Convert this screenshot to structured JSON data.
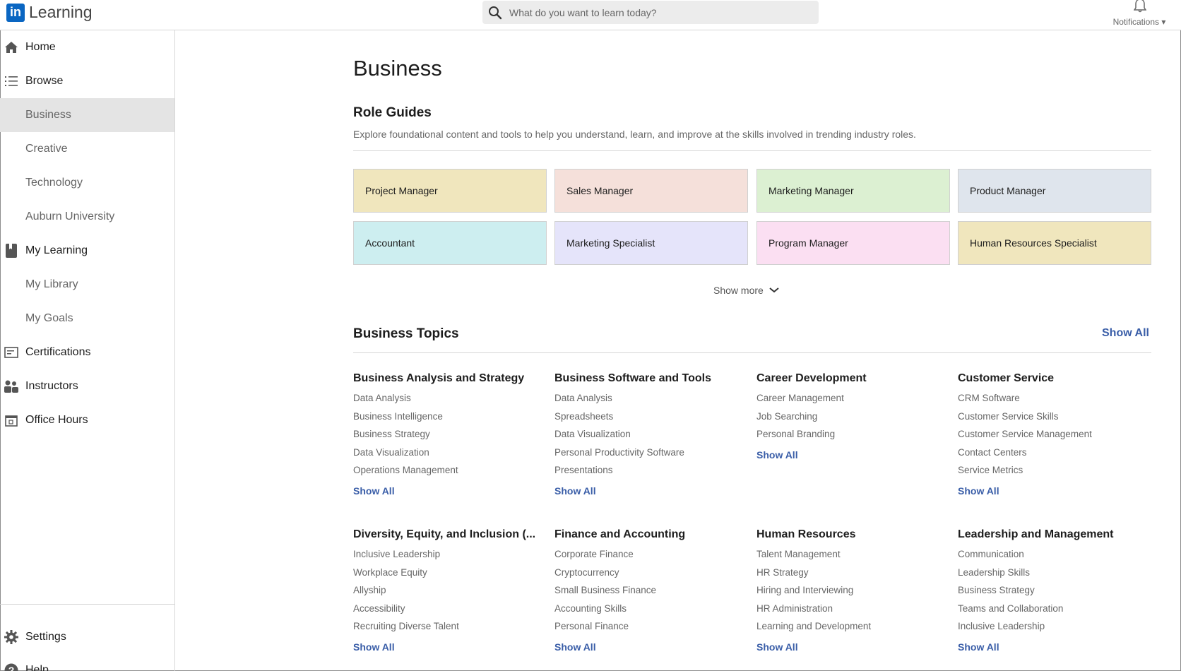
{
  "app": {
    "logo_mark": "in",
    "logo_text": "Learning"
  },
  "search": {
    "placeholder": "What do you want to learn today?"
  },
  "notifications": {
    "label": "Notifications"
  },
  "sidebar": {
    "items": [
      {
        "label": "Home",
        "icon": "home-icon"
      },
      {
        "label": "Browse",
        "icon": "list-icon"
      },
      {
        "label": "Business"
      },
      {
        "label": "Creative"
      },
      {
        "label": "Technology"
      },
      {
        "label": "Auburn University"
      },
      {
        "label": "My Learning",
        "icon": "bookmark-icon"
      },
      {
        "label": "My Library"
      },
      {
        "label": "My Goals"
      },
      {
        "label": "Certifications",
        "icon": "certificate-icon"
      },
      {
        "label": "Instructors",
        "icon": "people-icon"
      },
      {
        "label": "Office Hours",
        "icon": "calendar-icon"
      }
    ],
    "bottom": [
      {
        "label": "Settings",
        "icon": "gear-icon"
      },
      {
        "label": "Help",
        "icon": "help-icon"
      }
    ]
  },
  "main": {
    "title": "Business",
    "role_guides": {
      "title": "Role Guides",
      "description": "Explore foundational content and tools to help you understand, learn, and improve at the skills involved in trending industry roles.",
      "cards": [
        {
          "label": "Project Manager",
          "color": "#f0e6bd"
        },
        {
          "label": "Sales Manager",
          "color": "#f5e0da"
        },
        {
          "label": "Marketing Manager",
          "color": "#dcf0d2"
        },
        {
          "label": "Product Manager",
          "color": "#dfe5ed"
        },
        {
          "label": "Accountant",
          "color": "#cdeef0"
        },
        {
          "label": "Marketing Specialist",
          "color": "#e5e4fa"
        },
        {
          "label": "Program Manager",
          "color": "#fbdff2"
        },
        {
          "label": "Human Resources Specialist",
          "color": "#f0e6bd"
        }
      ],
      "show_more": "Show more"
    },
    "topics": {
      "title": "Business Topics",
      "show_all": "Show All",
      "groups": [
        {
          "title": "Business Analysis and Strategy",
          "items": [
            "Data Analysis",
            "Business Intelligence",
            "Business Strategy",
            "Data Visualization",
            "Operations Management"
          ],
          "show_all": "Show All"
        },
        {
          "title": "Business Software and Tools",
          "items": [
            "Data Analysis",
            "Spreadsheets",
            "Data Visualization",
            "Personal Productivity Software",
            "Presentations"
          ],
          "show_all": "Show All"
        },
        {
          "title": "Career Development",
          "items": [
            "Career Management",
            "Job Searching",
            "Personal Branding"
          ],
          "show_all": "Show All"
        },
        {
          "title": "Customer Service",
          "items": [
            "CRM Software",
            "Customer Service Skills",
            "Customer Service Management",
            "Contact Centers",
            "Service Metrics"
          ],
          "show_all": "Show All"
        },
        {
          "title": "Diversity, Equity, and Inclusion (...",
          "items": [
            "Inclusive Leadership",
            "Workplace Equity",
            "Allyship",
            "Accessibility",
            "Recruiting Diverse Talent"
          ],
          "show_all": "Show All"
        },
        {
          "title": "Finance and Accounting",
          "items": [
            "Corporate Finance",
            "Cryptocurrency",
            "Small Business Finance",
            "Accounting Skills",
            "Personal Finance"
          ],
          "show_all": "Show All"
        },
        {
          "title": "Human Resources",
          "items": [
            "Talent Management",
            "HR Strategy",
            "Hiring and Interviewing",
            "HR Administration",
            "Learning and Development"
          ],
          "show_all": "Show All"
        },
        {
          "title": "Leadership and Management",
          "items": [
            "Communication",
            "Leadership Skills",
            "Business Strategy",
            "Teams and Collaboration",
            "Inclusive Leadership"
          ],
          "show_all": "Show All"
        }
      ]
    }
  }
}
